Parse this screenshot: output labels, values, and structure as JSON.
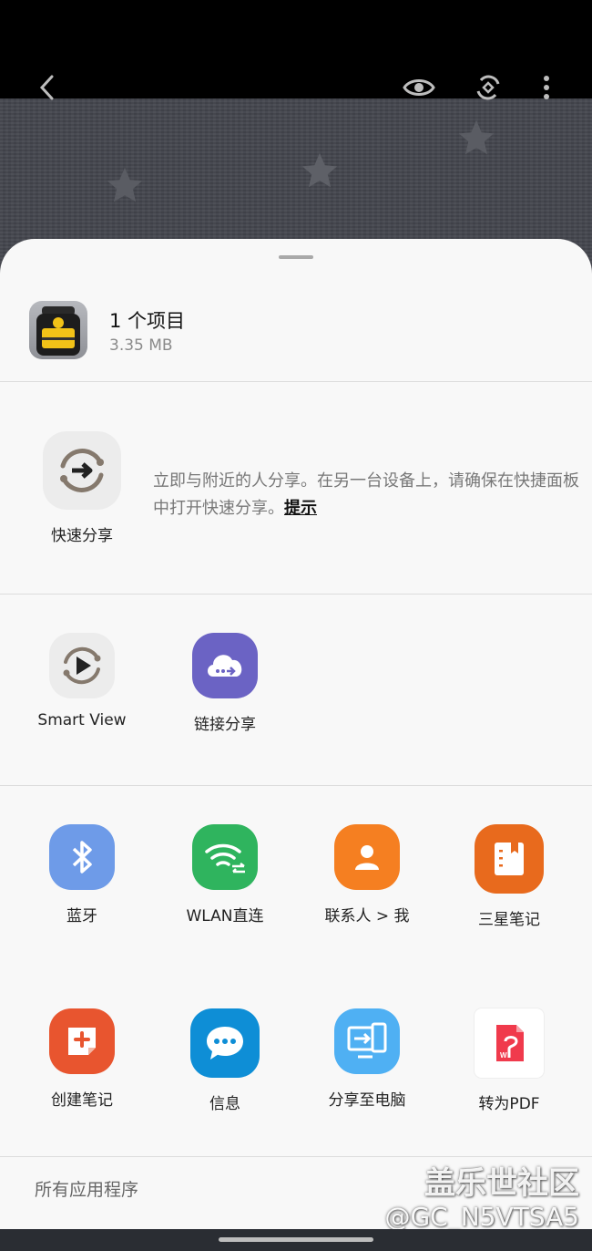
{
  "viewer": {
    "icons": [
      "back-arrow-icon",
      "eye-icon",
      "rotate-icon",
      "more-vert-icon"
    ]
  },
  "share_sheet": {
    "item_count": "1 个项目",
    "item_size": "3.35 MB",
    "quick_share": {
      "label": "快速分享",
      "description": "立即与附近的人分享。在另一台设备上，请确保在快捷面板中打开快速分享。",
      "link": "提示"
    },
    "row1": [
      {
        "label": "Smart View",
        "icon": "smart-view-icon"
      },
      {
        "label": "链接分享",
        "icon": "cloud-link-icon"
      }
    ],
    "row2": [
      {
        "label": "蓝牙",
        "icon": "bluetooth-icon",
        "color": "#6e9be8"
      },
      {
        "label": "WLAN直连",
        "icon": "wifi-direct-icon",
        "color": "#2fb45e"
      },
      {
        "label": "联系人 > 我",
        "icon": "contact-icon",
        "color": "#f57f21"
      },
      {
        "label": "三星笔记",
        "icon": "notes-icon",
        "color": "#e86a1d"
      }
    ],
    "row3": [
      {
        "label": "创建笔记",
        "icon": "create-note-icon",
        "color": "#e8552f"
      },
      {
        "label": "信息",
        "icon": "message-icon",
        "color": "#0e8ed6"
      },
      {
        "label": "分享至电脑",
        "icon": "share-pc-icon",
        "color": "#4fb0f3"
      },
      {
        "label": "转为PDF",
        "icon": "pdf-icon",
        "color": "#ffffff"
      }
    ],
    "all_apps": "所有应用程序"
  },
  "watermark": {
    "line1": "盖乐世社区",
    "line2": "@GC_N5VTSA5"
  }
}
